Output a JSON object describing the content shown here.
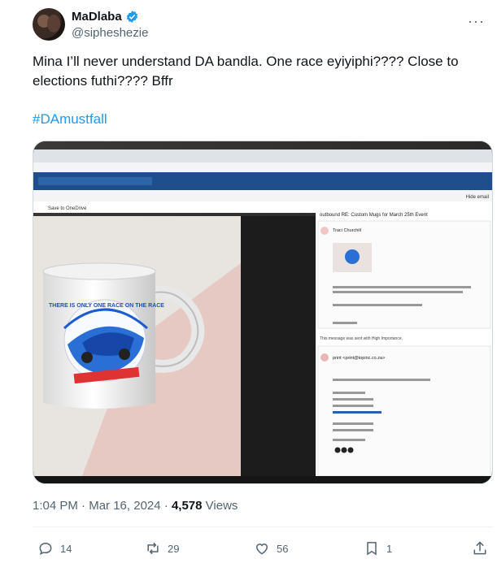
{
  "author": {
    "display_name": "MaDlaba",
    "handle": "@sipheshezie",
    "verified": true
  },
  "tweet": {
    "text": "Mina I’ll never understand DA bandla. One race eyiyiphi???? Close to elections futhi???? Bffr",
    "hashtag": "#DAmustfall"
  },
  "media": {
    "mug_text": "THERE IS ONLY ONE RACE ON THE RACE",
    "email_subject": "outbound RE: Custom Mugs for March 25th Event",
    "sender": "Traci Churchill",
    "reply_sender": "print <print@topinc.co.za>",
    "action_label": "Hide email",
    "save_label": "Save to OneDrive",
    "high_importance": "This message was sent with High Importance."
  },
  "meta": {
    "time": "1:04 PM",
    "date": "Mar 16, 2024",
    "views_count": "4,578",
    "views_label": "Views"
  },
  "stats": {
    "replies": "14",
    "reposts": "29",
    "likes": "56",
    "bookmarks": "1"
  },
  "colors": {
    "accent": "#1d9bf0",
    "secondary_text": "#536471"
  }
}
